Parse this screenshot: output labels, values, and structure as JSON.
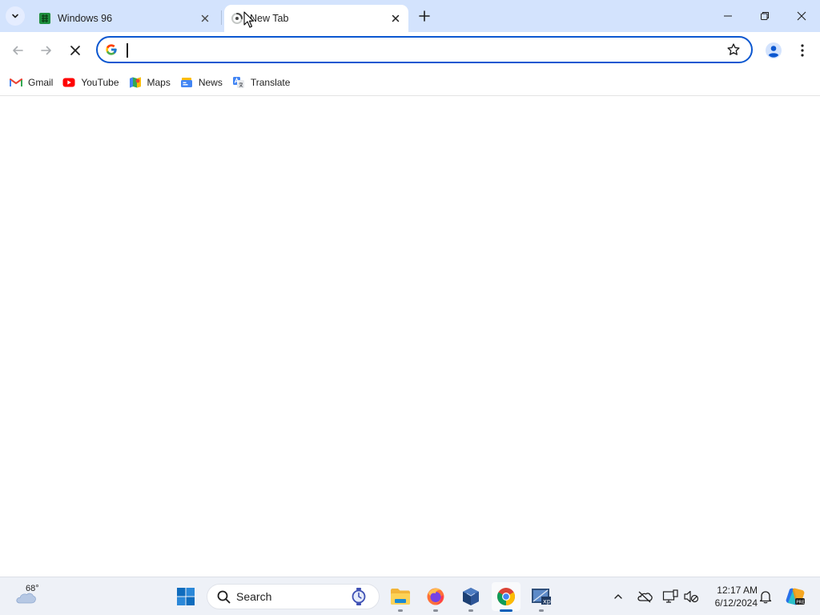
{
  "tabs": [
    {
      "title": "Windows 96",
      "active": false
    },
    {
      "title": "New Tab",
      "active": true
    }
  ],
  "omnibox": {
    "value": "",
    "placeholder": ""
  },
  "bookmarks": [
    {
      "label": "Gmail",
      "icon": "gmail-icon"
    },
    {
      "label": "YouTube",
      "icon": "youtube-icon"
    },
    {
      "label": "Maps",
      "icon": "maps-icon"
    },
    {
      "label": "News",
      "icon": "news-icon"
    },
    {
      "label": "Translate",
      "icon": "translate-icon"
    }
  ],
  "taskbar": {
    "weather_temp": "68°",
    "search_label": "Search",
    "time": "12:17 AM",
    "date": "6/12/2024",
    "pinned": [
      "file-explorer-icon",
      "firefox-icon",
      "virtualbox-icon",
      "chrome-icon",
      "xp-app-icon"
    ]
  },
  "colors": {
    "tabstrip": "#d3e3fd",
    "omnibox_border": "#0b57d0",
    "taskbar": "#eef1f7",
    "accent": "#005fb8"
  }
}
